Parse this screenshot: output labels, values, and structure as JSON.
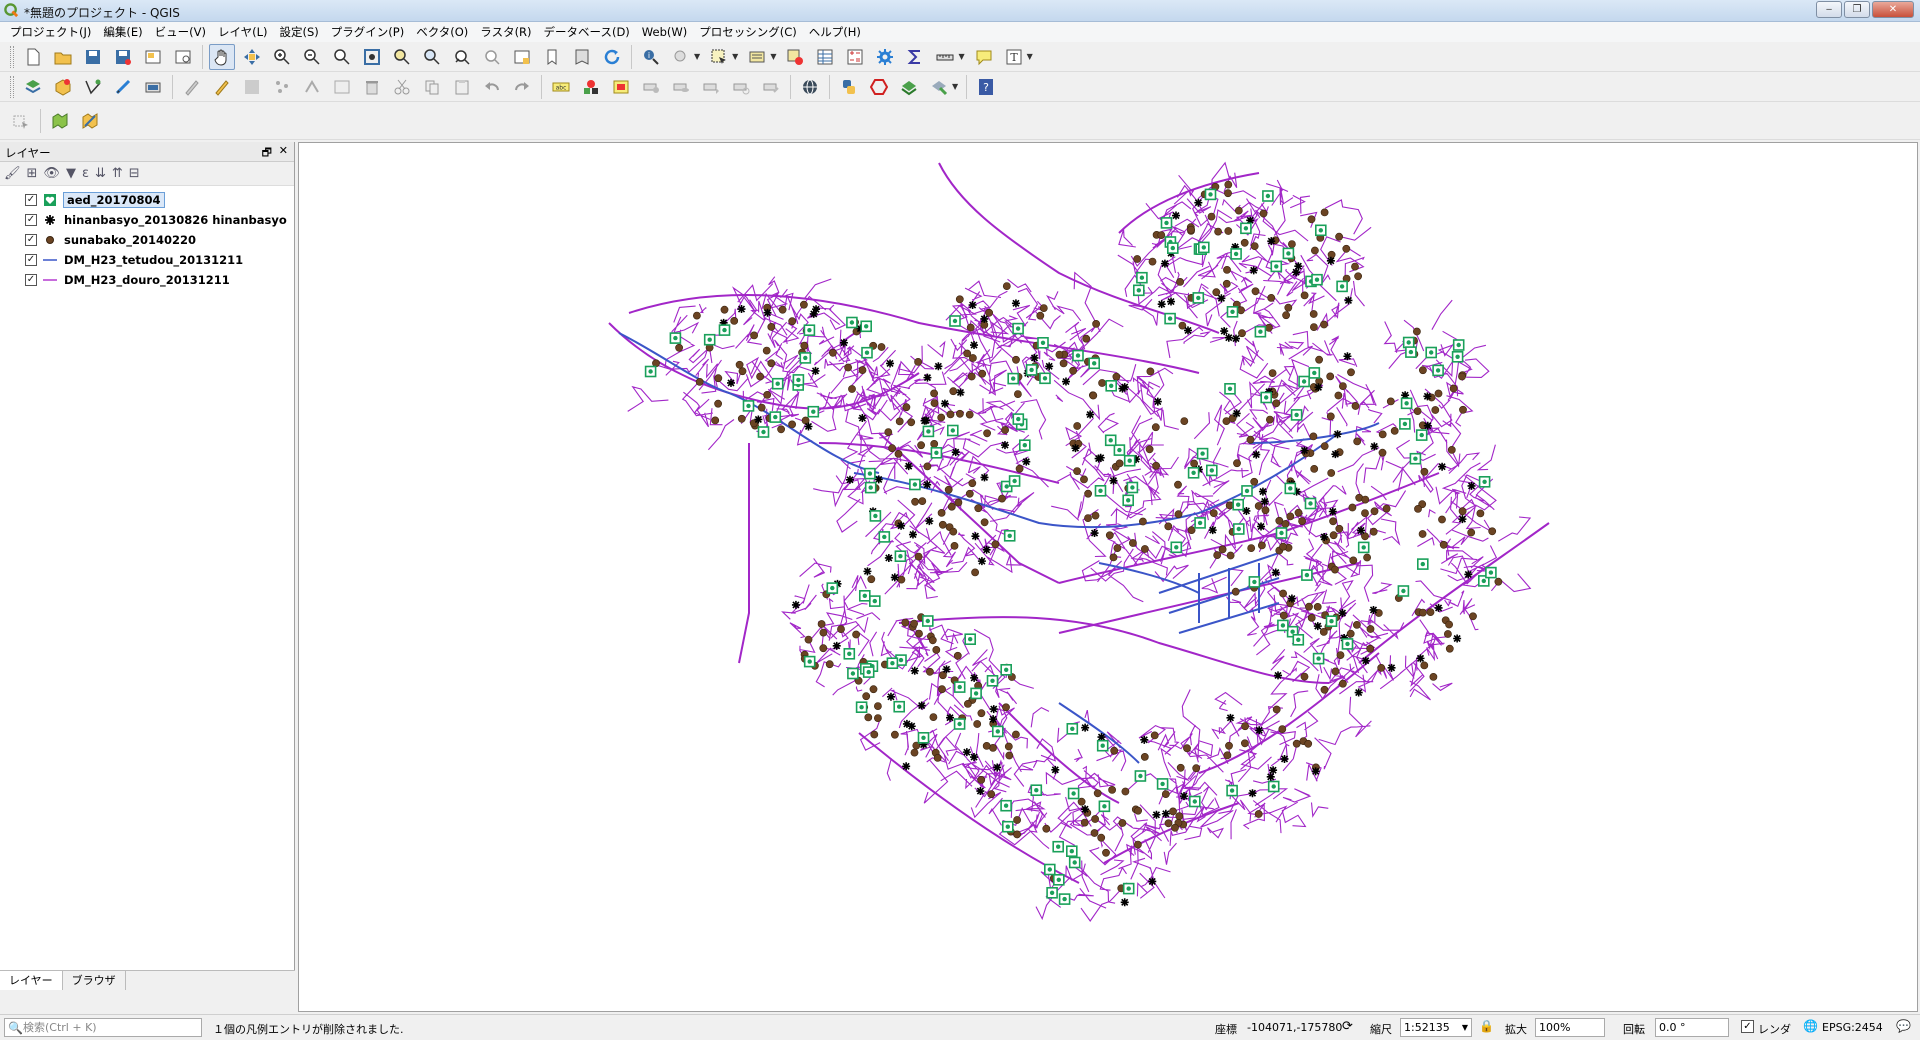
{
  "window": {
    "title": "*無題のプロジェクト - QGIS",
    "btn_minimize": "‒",
    "btn_maximize": "❐",
    "btn_close": "✕"
  },
  "menu": [
    "プロジェクト(J)",
    "編集(E)",
    "ビュー(V)",
    "レイヤ(L)",
    "設定(S)",
    "プラグイン(P)",
    "ベクタ(O)",
    "ラスタ(R)",
    "データベース(D)",
    "Web(W)",
    "プロセッシング(C)",
    "ヘルプ(H)"
  ],
  "panel": {
    "title": "レイヤー",
    "float_icon": "🗗",
    "close_icon": "✕",
    "tabs": [
      "レイヤー",
      "ブラウザ"
    ]
  },
  "layers": [
    {
      "name": "aed_20170804",
      "checked": "✓",
      "symbol": "aed-icon",
      "color": "#1aa05a",
      "selected": true
    },
    {
      "name": "hinanbasyo_20130826 hinanbasyo",
      "checked": "✓",
      "symbol": "asterisk-icon",
      "color": "#000000",
      "selected": false
    },
    {
      "name": "sunabako_20140220",
      "checked": "✓",
      "symbol": "circle-icon",
      "color": "#6b4423",
      "selected": false
    },
    {
      "name": "DM_H23_tetudou_20131211",
      "checked": "✓",
      "symbol": "line-icon",
      "color": "#3b55c8",
      "selected": false
    },
    {
      "name": "DM_H23_douro_20131211",
      "checked": "✓",
      "symbol": "line-icon",
      "color": "#b43ad0",
      "selected": false
    }
  ],
  "status": {
    "search_placeholder": "検索(Ctrl + K)",
    "search_icon": "🔍",
    "message": "１個の凡例エントリが削除されました.",
    "coord_label": "座標",
    "coord_value": "-104071,-175780",
    "scale_label": "縮尺",
    "scale_value": "1:52135",
    "magnify_label": "拡大",
    "magnify_value": "100%",
    "rotation_label": "回転",
    "rotation_value": "0.0 °",
    "render_label": "レンダ",
    "render_checked": "✓",
    "crs": "EPSG:2454"
  },
  "colors": {
    "road": "#a226c8",
    "rail": "#3b55c8",
    "sandbox": "#6b4423",
    "aed": "#1aa05a",
    "shelter": "#000000"
  }
}
